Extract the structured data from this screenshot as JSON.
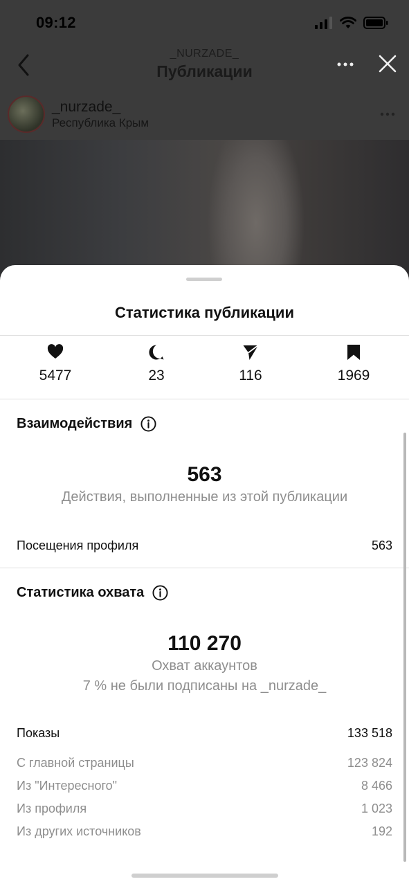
{
  "status_bar": {
    "time": "09:12"
  },
  "nav": {
    "subtitle": "_NURZADE_",
    "title": "Публикации"
  },
  "author": {
    "name": "_nurzade_",
    "location": "Республика Крым"
  },
  "sheet": {
    "title": "Статистика публикации",
    "metrics": [
      {
        "icon": "heart-icon",
        "value": "5477"
      },
      {
        "icon": "comment-icon",
        "value": "23"
      },
      {
        "icon": "send-icon",
        "value": "116"
      },
      {
        "icon": "bookmark-icon",
        "value": "1969"
      }
    ],
    "interactions": {
      "title": "Взаимодействия",
      "total": "563",
      "caption": "Действия, выполненные из этой публикации",
      "rows": [
        {
          "label": "Посещения профиля",
          "value": "563"
        }
      ]
    },
    "reach": {
      "title": "Статистика охвата",
      "total": "110 270",
      "caption": "Охват аккаунтов",
      "caption2": "7 % не были подписаны на _nurzade_",
      "impressions": {
        "label": "Показы",
        "value": "133 518"
      },
      "sources": [
        {
          "label": "С главной страницы",
          "value": "123 824"
        },
        {
          "label": "Из \"Интересного\"",
          "value": "8 466"
        },
        {
          "label": "Из профиля",
          "value": "1 023"
        },
        {
          "label": "Из других источников",
          "value": "192"
        }
      ]
    }
  },
  "colors": {
    "text": "#111111",
    "muted": "#8e8e8e",
    "separator": "#dedede",
    "dim_background": "#3b3b3b"
  }
}
